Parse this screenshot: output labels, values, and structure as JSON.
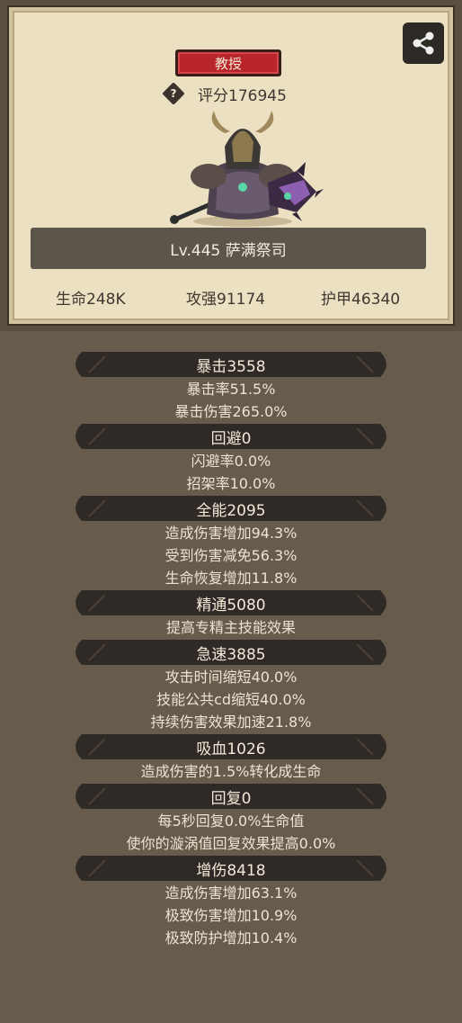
{
  "header": {
    "title_badge": "教授",
    "score_label": "评分176945",
    "level_name": "Lv.445 萨满祭司",
    "stats": {
      "hp": "生命248K",
      "attack": "攻强91174",
      "armor": "护甲46340"
    }
  },
  "groups": [
    {
      "title": "暴击3558",
      "lines": [
        "暴击率51.5%",
        "暴击伤害265.0%"
      ]
    },
    {
      "title": "回避0",
      "lines": [
        "闪避率0.0%",
        "招架率10.0%"
      ]
    },
    {
      "title": "全能2095",
      "lines": [
        "造成伤害增加94.3%",
        "受到伤害减免56.3%",
        "生命恢复增加11.8%"
      ]
    },
    {
      "title": "精通5080",
      "lines": [
        "提高专精主技能效果"
      ]
    },
    {
      "title": "急速3885",
      "lines": [
        "攻击时间缩短40.0%",
        "技能公共cd缩短40.0%",
        "持续伤害效果加速21.8%"
      ]
    },
    {
      "title": "吸血1026",
      "lines": [
        "造成伤害的1.5%转化成生命"
      ]
    },
    {
      "title": "回复0",
      "lines": [
        "每5秒回复0.0%生命值",
        "使你的漩涡值回复效果提高0.0%"
      ]
    },
    {
      "title": "增伤8418",
      "lines": [
        "造成伤害增加63.1%",
        "极致伤害增加10.9%",
        "极致防护增加10.4%"
      ]
    }
  ],
  "icons": {
    "share": "share-icon",
    "help": "help-icon",
    "character": "character-portrait"
  },
  "colors": {
    "background": "#675c4c",
    "parchment": "#ece0c2",
    "badge": "#b8262c",
    "header_bar": "#2f2a25",
    "text_light": "#ece3d2"
  }
}
